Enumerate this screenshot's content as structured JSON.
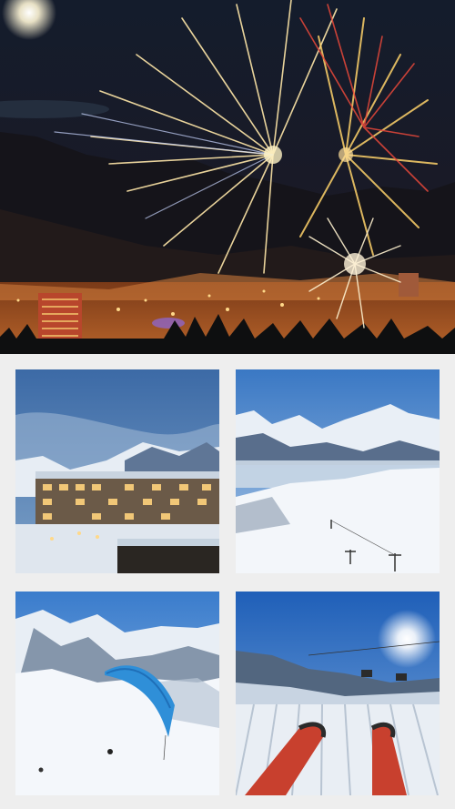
{
  "collage": {
    "hero": {
      "subject": "fireworks-over-ski-resort-at-night"
    },
    "tiles": [
      {
        "subject": "resort-building-at-dusk-in-snow"
      },
      {
        "subject": "snowy-mountain-panorama-with-ski-lifts"
      },
      {
        "subject": "paraglider-over-snowy-slopes"
      },
      {
        "subject": "skis-on-groomed-piste-with-chairlift-and-sun"
      }
    ]
  },
  "colors": {
    "background": "#eeeeee",
    "night_sky": "#0d1422",
    "firework_gold": "#ffd36a",
    "firework_red": "#e8483a",
    "dusk_blue": "#3c6aa6",
    "day_sky": "#2f6fc2",
    "snow": "#f3f6fa",
    "paraglider": "#2f8fd8",
    "ski_red": "#c8402e"
  }
}
